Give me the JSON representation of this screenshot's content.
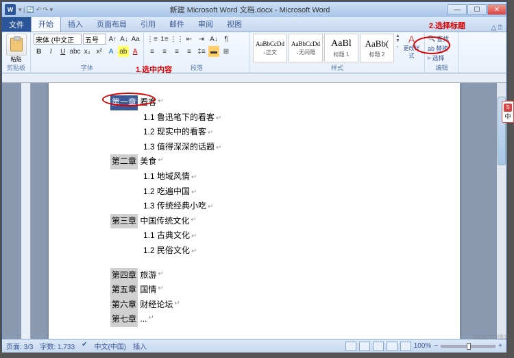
{
  "title_doc": "新建 Microsoft Word 文档.docx - Microsoft Word",
  "tabs": {
    "file": "文件",
    "items": [
      "开始",
      "插入",
      "页面布局",
      "引用",
      "邮件",
      "审阅",
      "视图"
    ],
    "active": "开始"
  },
  "ribbon": {
    "clipboard": {
      "paste": "粘贴",
      "label": "剪贴板"
    },
    "font": {
      "name": "宋体 (中文正",
      "size": "五号",
      "label": "字体"
    },
    "paragraph": {
      "label": "段落"
    },
    "styles": {
      "items": [
        {
          "preview": "AaBbCcDd",
          "label": "↓正文",
          "size": "9px"
        },
        {
          "preview": "AaBbCcDd",
          "label": "↓无间隔",
          "size": "9px"
        },
        {
          "preview": "AaBl",
          "label": "标题 1",
          "size": "14px"
        },
        {
          "preview": "AaBb(",
          "label": "标题 2",
          "size": "13px"
        }
      ],
      "change": "更改样式",
      "label": "样式"
    },
    "editing": {
      "find": "查找",
      "replace": "替换",
      "select": "选择",
      "label": "编辑"
    }
  },
  "annotations": {
    "a1": "1.选中内容",
    "a2": "2.选择标题"
  },
  "document": {
    "ch1": {
      "h": "第一章",
      "t": "看客",
      "subs": [
        "1.1 鲁迅笔下的看客",
        "1.2 现实中的看客",
        "1.3 值得深深的话题"
      ]
    },
    "ch2": {
      "h": "第二章",
      "t": "美食",
      "subs": [
        "1.1 地域风情",
        "1.2 吃遍中国",
        "1.3 传统经典小吃"
      ]
    },
    "ch3": {
      "h": "第三章",
      "t": "中国传统文化",
      "subs": [
        "1.1 古典文化",
        "1.2 民俗文化"
      ]
    },
    "ch4": {
      "h": "第四章",
      "t": "旅游"
    },
    "ch5": {
      "h": "第五章",
      "t": "国情"
    },
    "ch6": {
      "h": "第六章",
      "t": "财经论坛"
    },
    "ch7": {
      "h": "第七章",
      "t": "..."
    }
  },
  "statusbar": {
    "page": "页面: 3/3",
    "words": "字数: 1,733",
    "lang": "中文(中国)",
    "mode": "插入",
    "zoom": "100%",
    "zm": "−",
    "zp": "+"
  },
  "side_label": "中",
  "watermark": "©51CTO博客"
}
